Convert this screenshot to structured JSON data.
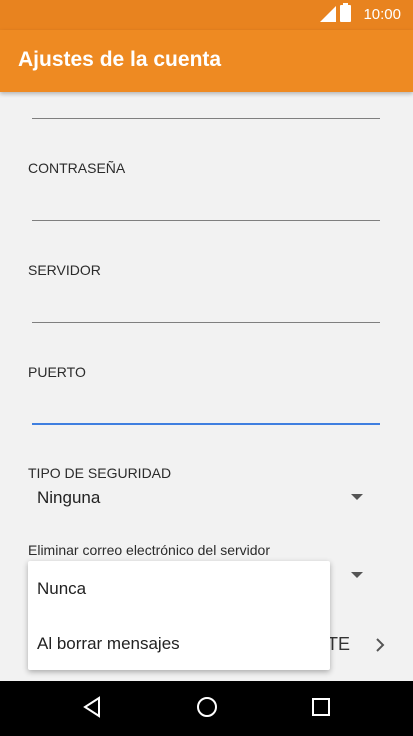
{
  "status": {
    "time": "10:00"
  },
  "appbar": {
    "title": "Ajustes de la cuenta"
  },
  "fields": {
    "password_label": "CONTRASEÑA",
    "server_label": "SERVIDOR",
    "port_label": "PUERTO",
    "security_label": "TIPO DE SEGURIDAD",
    "security_value": "Ninguna",
    "delete_label": "Eliminar correo electrónico del servidor"
  },
  "dropdown": {
    "options": [
      "Nunca",
      "Al borrar mensajes"
    ]
  },
  "footer": {
    "button_partial": "TE"
  },
  "colors": {
    "accent": "#ee8a22",
    "focus_line": "#3f7fe0"
  }
}
